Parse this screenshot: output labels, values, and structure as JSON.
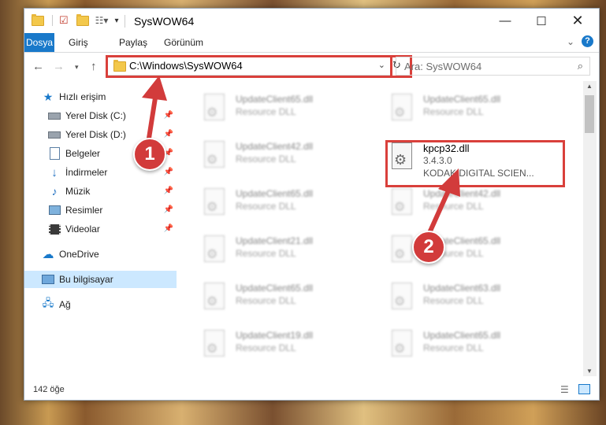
{
  "window": {
    "title": "SysWOW64"
  },
  "ribbon": {
    "tabs": [
      "Dosya",
      "Giriş",
      "Paylaş",
      "Görünüm"
    ],
    "active_tab": "Dosya"
  },
  "address": {
    "path": "C:\\Windows\\SysWOW64",
    "search_placeholder": "Ara: SysWOW64"
  },
  "sidebar": {
    "items": [
      {
        "label": "Hızlı erişim",
        "icon": "star-icon"
      },
      {
        "label": "Yerel Disk (C:)",
        "icon": "drive-icon"
      },
      {
        "label": "Yerel Disk (D:)",
        "icon": "drive-icon"
      },
      {
        "label": "Belgeler",
        "icon": "documents-icon"
      },
      {
        "label": "İndirmeler",
        "icon": "download-icon"
      },
      {
        "label": "Müzik",
        "icon": "music-icon"
      },
      {
        "label": "Resimler",
        "icon": "pictures-icon"
      },
      {
        "label": "Videolar",
        "icon": "video-icon"
      },
      {
        "label": "OneDrive",
        "icon": "cloud-icon"
      },
      {
        "label": "Bu bilgisayar",
        "icon": "computer-icon"
      },
      {
        "label": "Ağ",
        "icon": "network-icon"
      }
    ]
  },
  "files": {
    "highlighted": {
      "name": "kpcp32.dll",
      "version": "3.4.3.0",
      "company": "KODAK DIGITAL SCIEN..."
    },
    "left_column": [
      {
        "name": "UpdateClient65.dll",
        "type": "Resource DLL"
      },
      {
        "name": "UpdateClient42.dll",
        "type": "Resource DLL"
      },
      {
        "name": "UpdateClient65.dll",
        "type": "Resource DLL"
      },
      {
        "name": "UpdateClient21.dll",
        "type": "Resource DLL"
      },
      {
        "name": "UpdateClient65.dll",
        "type": "Resource DLL"
      },
      {
        "name": "UpdateClient19.dll",
        "type": "Resource DLL"
      }
    ],
    "right_column": [
      {
        "name": "UpdateClient65.dll",
        "type": "Resource DLL"
      },
      {
        "name": "UpdateClient42.dll",
        "type": "Resource DLL"
      },
      {
        "name": "UpdateClient65.dll",
        "type": "Resource DLL"
      },
      {
        "name": "UpdateClient63.dll",
        "type": "Resource DLL"
      },
      {
        "name": "UpdateClient65.dll",
        "type": "Resource DLL"
      }
    ]
  },
  "status": {
    "count": "142 öğe"
  },
  "annotations": {
    "badge1": "1",
    "badge2": "2"
  },
  "colors": {
    "accent": "#1979ca",
    "highlight": "#d9403b",
    "badge": "#d23b3b"
  }
}
